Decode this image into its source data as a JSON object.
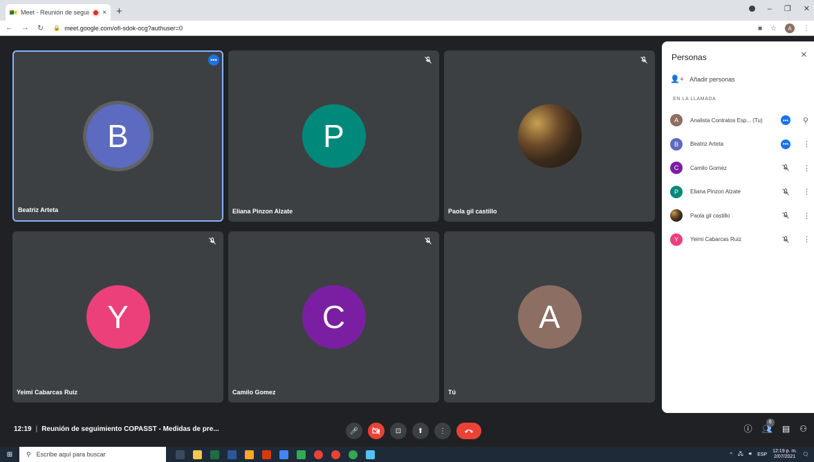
{
  "browser": {
    "tab_title": "Meet - Reunión de seguimie",
    "tab_close": "×",
    "new_tab": "+",
    "url": "meet.google.com/ofi-sdok-ocg?authuser=0",
    "profile_initial": "A",
    "window_controls": {
      "minimize": "–",
      "restore": "❐",
      "close": "✕"
    }
  },
  "tiles": [
    {
      "name": "Beatriz Arteta",
      "initial": "B",
      "color": "#5c6bc0",
      "active": true,
      "muted": false
    },
    {
      "name": "Eliana Pinzon Alzate",
      "initial": "P",
      "color": "#00897b",
      "active": false,
      "muted": true
    },
    {
      "name": "Paola gil castillo",
      "initial": "",
      "color": "#6b4a2a",
      "active": false,
      "muted": true,
      "photo": true
    },
    {
      "name": "Yeimi Cabarcas Ruiz",
      "initial": "Y",
      "color": "#ec407a",
      "active": false,
      "muted": true
    },
    {
      "name": "Camilo Gomez",
      "initial": "C",
      "color": "#7b1fa2",
      "active": false,
      "muted": true
    },
    {
      "name": "Tú",
      "initial": "A",
      "color": "#8d6e63",
      "active": false,
      "muted": false
    }
  ],
  "panel": {
    "title": "Personas",
    "close": "×",
    "add_people": "Añadir personas",
    "section": "EN LA LLAMADA",
    "people": [
      {
        "name": "Analista Contratos Esp... (Tu)",
        "initial": "A",
        "color": "#8d6e63",
        "status": "speaking",
        "action": "pin-icon"
      },
      {
        "name": "Beatriz Arteta",
        "initial": "B",
        "color": "#5c6bc0",
        "status": "speaking",
        "action": "more-icon"
      },
      {
        "name": "Camilo Gomez",
        "initial": "C",
        "color": "#7b1fa2",
        "status": "muted",
        "action": "more-icon"
      },
      {
        "name": "Eliana Pinzon Alzate",
        "initial": "P",
        "color": "#00897b",
        "status": "muted",
        "action": "more-icon"
      },
      {
        "name": "Paola gil castillo",
        "initial": "",
        "color": "#6b4a2a",
        "status": "muted",
        "action": "more-icon",
        "photo": true
      },
      {
        "name": "Yeimi Cabarcas Ruiz",
        "initial": "Y",
        "color": "#ec407a",
        "status": "muted",
        "action": "more-icon"
      }
    ]
  },
  "meeting": {
    "time": "12:19",
    "separator": "|",
    "title": "Reunión de seguimiento COPASST - Medidas de pre...",
    "participant_count": "6"
  },
  "taskbar": {
    "search_placeholder": "Escribe aquí para buscar",
    "language": "ESP",
    "time": "12:19 p. m.",
    "date": "2/07/2021"
  }
}
